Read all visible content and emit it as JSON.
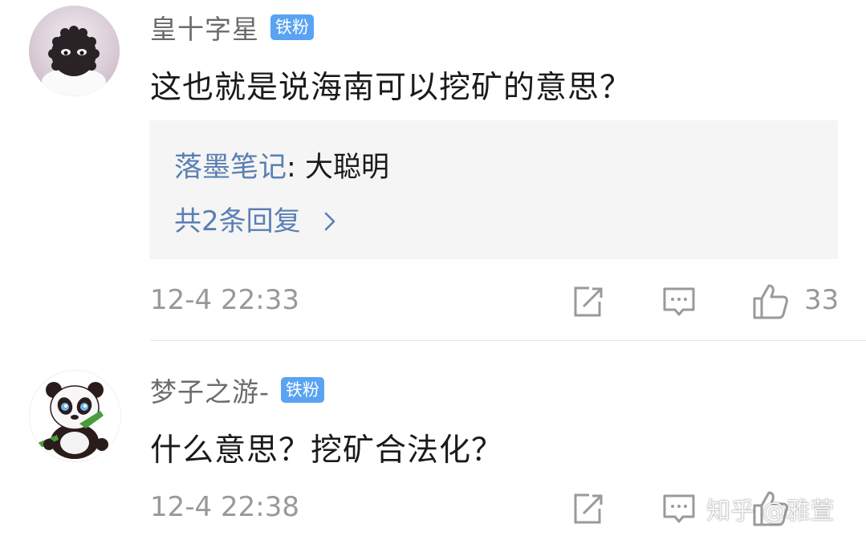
{
  "comments": [
    {
      "username": "皇十字星",
      "badge": "铁粉",
      "content": "这也就是说海南可以挖矿的意思？",
      "reply_preview": {
        "author": "落墨笔记",
        "separator": ": ",
        "text": "大聪明"
      },
      "reply_more": "共2条回复",
      "time": "12-4 22:33",
      "likes": "33",
      "avatar_icon": "black-furball-avatar"
    },
    {
      "username": "梦子之游-",
      "badge": "铁粉",
      "content": "什么意思？挖矿合法化？",
      "time": "12-4 22:38",
      "avatar_icon": "panda-avatar"
    }
  ],
  "icons": {
    "share": "share-icon",
    "reply": "comment-icon",
    "like": "thumbs-up-icon",
    "chevron": "chevron-right-icon"
  },
  "watermark": "知乎 @雅萱",
  "colors": {
    "badge": "#59a3f2",
    "link": "#5a7fb3",
    "meta": "#999999",
    "reply_bg": "#f5f5f5"
  }
}
